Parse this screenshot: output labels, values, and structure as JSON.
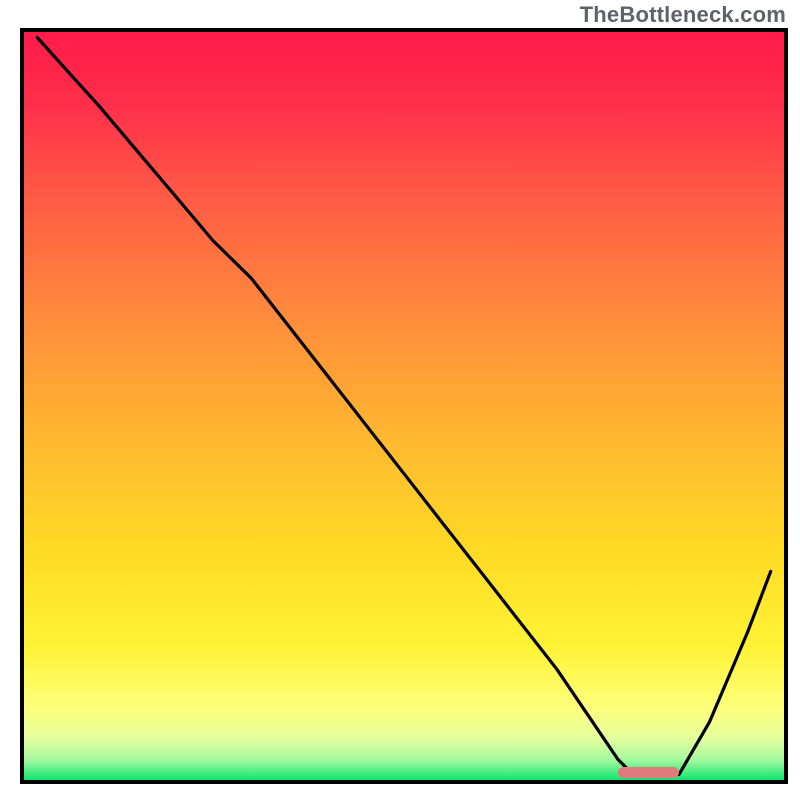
{
  "watermark": "TheBottleneck.com",
  "chart_data": {
    "type": "line",
    "title": "",
    "xlabel": "",
    "ylabel": "",
    "xlim": [
      0,
      100
    ],
    "ylim": [
      0,
      100
    ],
    "grid": false,
    "legend": false,
    "background_gradient": {
      "from_color": "#ff1a4b",
      "to_color": "#00e46a",
      "mid_color": "#ffd400"
    },
    "series": [
      {
        "name": "curve",
        "stroke": "#000000",
        "x": [
          2,
          10,
          20,
          25,
          30,
          40,
          50,
          60,
          70,
          78,
          80,
          83,
          86,
          90,
          95,
          98
        ],
        "values": [
          99,
          90,
          78,
          72,
          67,
          54,
          41,
          28,
          15,
          3,
          1,
          1,
          1,
          8,
          20,
          28
        ]
      }
    ],
    "marker": {
      "name": "trough-marker",
      "color": "#e07a7d",
      "x_start": 78,
      "x_end": 86,
      "y": 0.6,
      "height": 1.4
    }
  }
}
